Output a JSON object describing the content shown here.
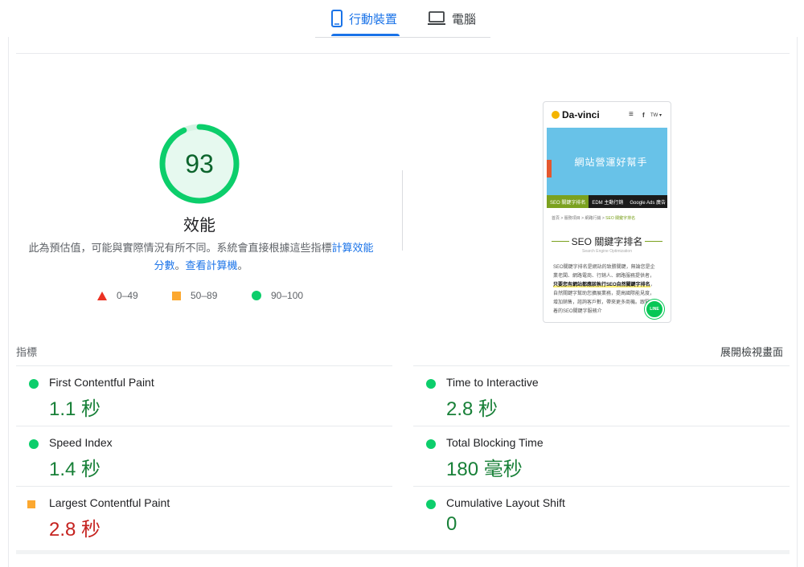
{
  "tabs": [
    {
      "label": "行動裝置",
      "icon": "mobile-phone-icon",
      "active": true
    },
    {
      "label": "電腦",
      "icon": "desktop-monitor-icon",
      "active": false
    }
  ],
  "score": {
    "value": 93,
    "category": "效能",
    "fraction": 0.93,
    "color": "#0cce6b"
  },
  "description": {
    "text": "此為預估值，可能與實際情況有所不同。系統會直接根據這些指標",
    "link1": "計算效能分數",
    "sep": "。",
    "link2": "查看計算機",
    "end": "。"
  },
  "legend": [
    {
      "range": "0–49",
      "shape": "triangle",
      "color": "#eb3223"
    },
    {
      "range": "50–89",
      "shape": "square",
      "color": "#fca830"
    },
    {
      "range": "90–100",
      "shape": "circle",
      "color": "#0cce6b"
    }
  ],
  "screenshot": {
    "logo": "Da-vinci",
    "tw": "TW",
    "banner_text": "網站營運好幫手",
    "nav": [
      "SEO 關鍵字排名",
      "EDM 主動行銷",
      "Google Ads 廣告"
    ],
    "breadcrumb": [
      "首頁",
      "服務項目",
      "網路行銷",
      "SEO 關鍵字排名"
    ],
    "heading": "SEO 關鍵字排名",
    "subheading": "Search Engine Optimization",
    "body_start": "SEO關鍵字排名是網站的致勝關鍵，無論您是企業老闆、網路電商、行銷人、網路服務提供者，",
    "body_highlight": "只要您有網站都應該執行SEO自然關鍵字排名",
    "body_end": "，自然關鍵字幫助您擴展業務，提高國際能見度，增加銷售，諮詢客戶數，帶來更多商機。跟緊跟着的SEO關鍵字服務介",
    "line_badge": "LINE"
  },
  "metrics_header": {
    "label": "指標",
    "expand": "展開檢視畫面"
  },
  "metrics": [
    {
      "name": "First Contentful Paint",
      "value": "1.1 秒",
      "rating": "good"
    },
    {
      "name": "Time to Interactive",
      "value": "2.8 秒",
      "rating": "good"
    },
    {
      "name": "Speed Index",
      "value": "1.4 秒",
      "rating": "good"
    },
    {
      "name": "Total Blocking Time",
      "value": "180 毫秒",
      "rating": "good"
    },
    {
      "name": "Largest Contentful Paint",
      "value": "2.8 秒",
      "rating": "average"
    },
    {
      "name": "Cumulative Layout Shift",
      "value": "0",
      "rating": "good"
    }
  ]
}
